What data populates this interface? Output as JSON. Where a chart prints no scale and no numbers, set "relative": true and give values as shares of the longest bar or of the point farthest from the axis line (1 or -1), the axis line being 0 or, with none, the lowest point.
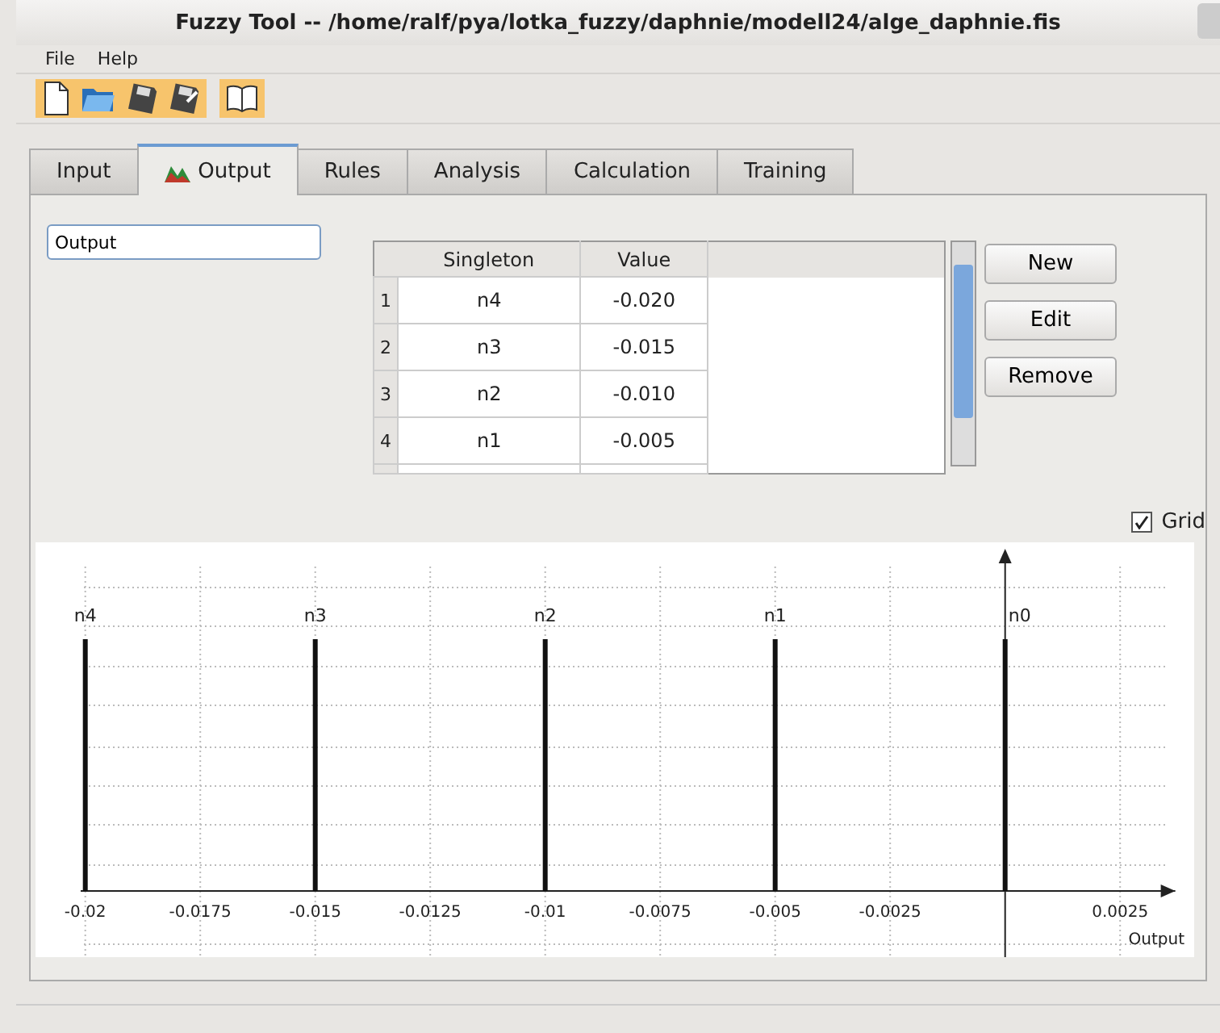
{
  "window": {
    "title": "Fuzzy Tool -- /home/ralf/pya/lotka_fuzzy/daphnie/modell24/alge_daphnie.fis"
  },
  "menu": [
    "File",
    "Help"
  ],
  "tabs": [
    {
      "label": "Input",
      "selected": false
    },
    {
      "label": "Output",
      "selected": true
    },
    {
      "label": "Rules",
      "selected": false
    },
    {
      "label": "Analysis",
      "selected": false
    },
    {
      "label": "Calculation",
      "selected": false
    },
    {
      "label": "Training",
      "selected": false
    }
  ],
  "name_field": {
    "value": "Output"
  },
  "table": {
    "columns": [
      "Singleton",
      "Value"
    ],
    "rows": [
      {
        "index": "1",
        "singleton": "n4",
        "value": "-0.020"
      },
      {
        "index": "2",
        "singleton": "n3",
        "value": "-0.015"
      },
      {
        "index": "3",
        "singleton": "n2",
        "value": "-0.010"
      },
      {
        "index": "4",
        "singleton": "n1",
        "value": "-0.005"
      }
    ]
  },
  "buttons": [
    "New",
    "Edit",
    "Remove"
  ],
  "grid_checkbox": {
    "label": "Grid",
    "checked": true
  },
  "chart_data": {
    "type": "bar",
    "x": [
      -0.02,
      -0.015,
      -0.01,
      -0.005,
      0
    ],
    "values": [
      1,
      1,
      1,
      1,
      1
    ],
    "relative": true,
    "grid": true,
    "xlabel": "Output",
    "xlim": [
      -0.0201,
      0.0037
    ],
    "xticks": [
      {
        "value": -0.02,
        "label": "-0.02"
      },
      {
        "value": -0.0175,
        "label": "-0.0175"
      },
      {
        "value": -0.015,
        "label": "-0.015"
      },
      {
        "value": -0.0125,
        "label": "-0.0125"
      },
      {
        "value": -0.01,
        "label": "-0.01"
      },
      {
        "value": -0.0075,
        "label": "-0.0075"
      },
      {
        "value": -0.005,
        "label": "-0.005"
      },
      {
        "value": -0.0025,
        "label": "-0.0025"
      },
      {
        "value": 0.0025,
        "label": "0.0025"
      }
    ],
    "annotations": [
      "n4",
      "n3",
      "n2",
      "n1",
      "n0"
    ]
  }
}
